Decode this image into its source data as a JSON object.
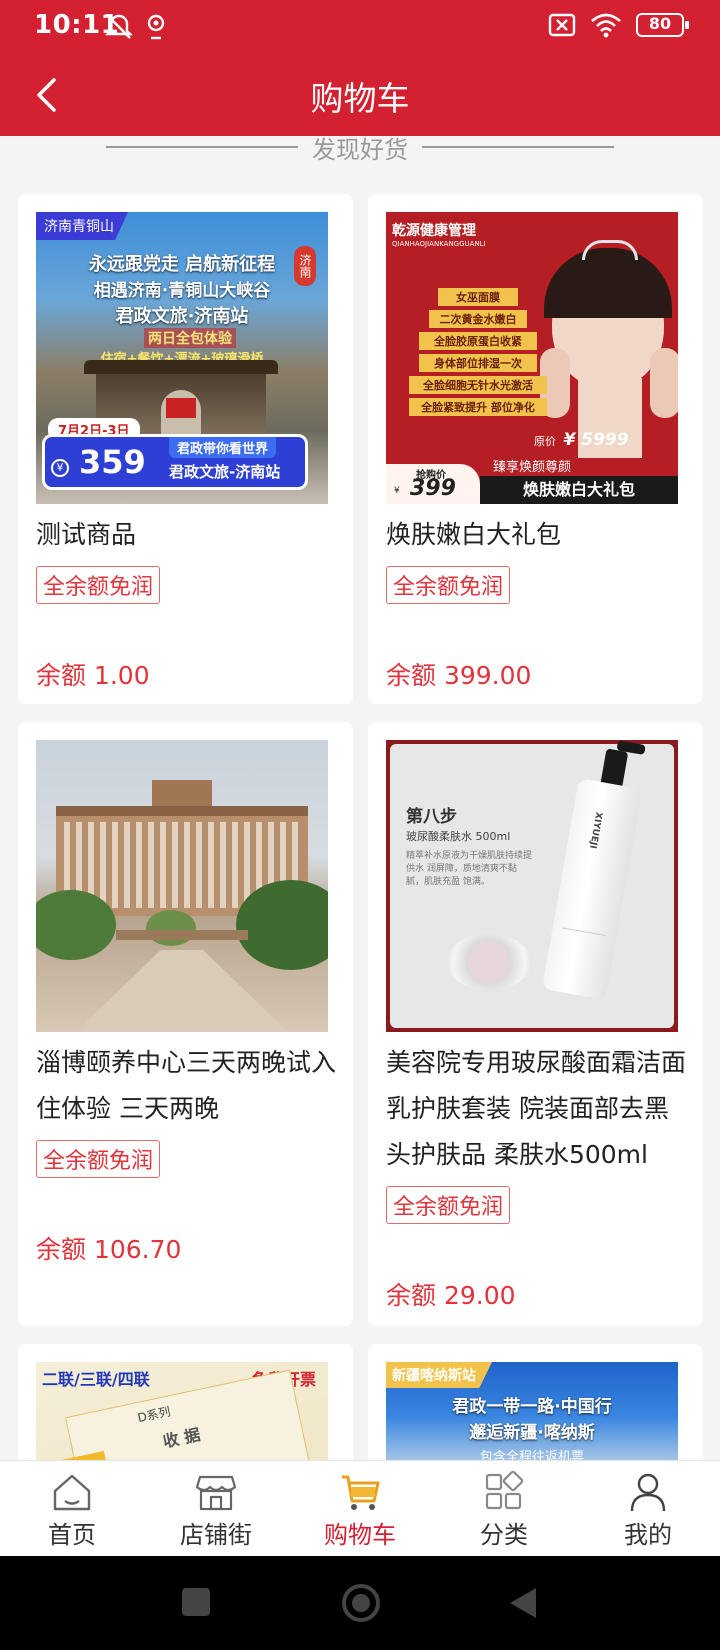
{
  "status_bar": {
    "time": "10:11",
    "battery": "80"
  },
  "header": {
    "title": "购物车"
  },
  "section": {
    "title": "发现好货"
  },
  "products": [
    {
      "title": "测试商品",
      "badge": "全余额免润",
      "price": "余额 1.00",
      "image": {
        "corner_tag": "济南青铜山",
        "line1": "永远跟党走 启航新征程",
        "line2": "相遇济南·青铜山大峡谷",
        "line3": "君政文旅·济南站",
        "line4": "两日全包体验",
        "line5": "住宿+餐饮+漂流+玻璃滑桥",
        "seal": "济南",
        "date": "7月2日-3日",
        "price": "359",
        "slogan": "君政带你看世界",
        "brand": "君政文旅-济南站"
      }
    },
    {
      "title": "焕肤嫩白大礼包",
      "badge": "全余额免润",
      "price": "余额 399.00",
      "image": {
        "brand": "乾源健康管理",
        "brand_en": "QIANHAOJIANKANGGUANLI",
        "items": [
          "女巫面膜",
          "二次黄金水嫩白",
          "全脸胶原蛋白收紧",
          "身体部位排湿一次",
          "全脸细胞无针水光激活",
          "全脸紧致提升 部位净化"
        ],
        "orig_label": "原价",
        "orig_price": "¥ 5999",
        "promo_label": "抢购价",
        "promo_price": "399",
        "slogan": "臻享焕颜尊颜",
        "banner": "焕肤嫩白大礼包"
      }
    },
    {
      "title": "淄博颐养中心三天两晚试入住体验 三天两晚",
      "badge": "全余额免润",
      "price": "余额 106.70"
    },
    {
      "title": "美容院专用玻尿酸面霜洁面乳护肤套装 院装面部去黑头护肤品 柔肤水500ml",
      "badge": "全余额免润",
      "price": "余额 29.00",
      "image": {
        "step": "第八步",
        "name": "玻尿酸柔肤水 500ml",
        "desc": "精萃补水原液为干燥肌肤持续提供水 润屏障，质地清爽不黏腻，肌肤充盈 饱满。",
        "bottle_brand": "XIYUEJI"
      }
    },
    {
      "image": {
        "left": "二联/三联/四联",
        "right": "免费开票",
        "series": "D系列",
        "doc": "收 据"
      }
    },
    {
      "image": {
        "tag": "新疆喀纳斯站",
        "line1": "君政一带一路·中国行",
        "line2": "邂逅新疆·喀纳斯",
        "line3": "包含全程往返机票"
      }
    }
  ],
  "tabs": [
    {
      "label": "首页",
      "icon": "home-icon"
    },
    {
      "label": "店铺街",
      "icon": "store-icon"
    },
    {
      "label": "购物车",
      "icon": "cart-icon"
    },
    {
      "label": "分类",
      "icon": "category-icon"
    },
    {
      "label": "我的",
      "icon": "user-icon"
    }
  ],
  "colors": {
    "brand": "#d32131",
    "price": "#e2333b",
    "tab_active": "#d32131"
  }
}
